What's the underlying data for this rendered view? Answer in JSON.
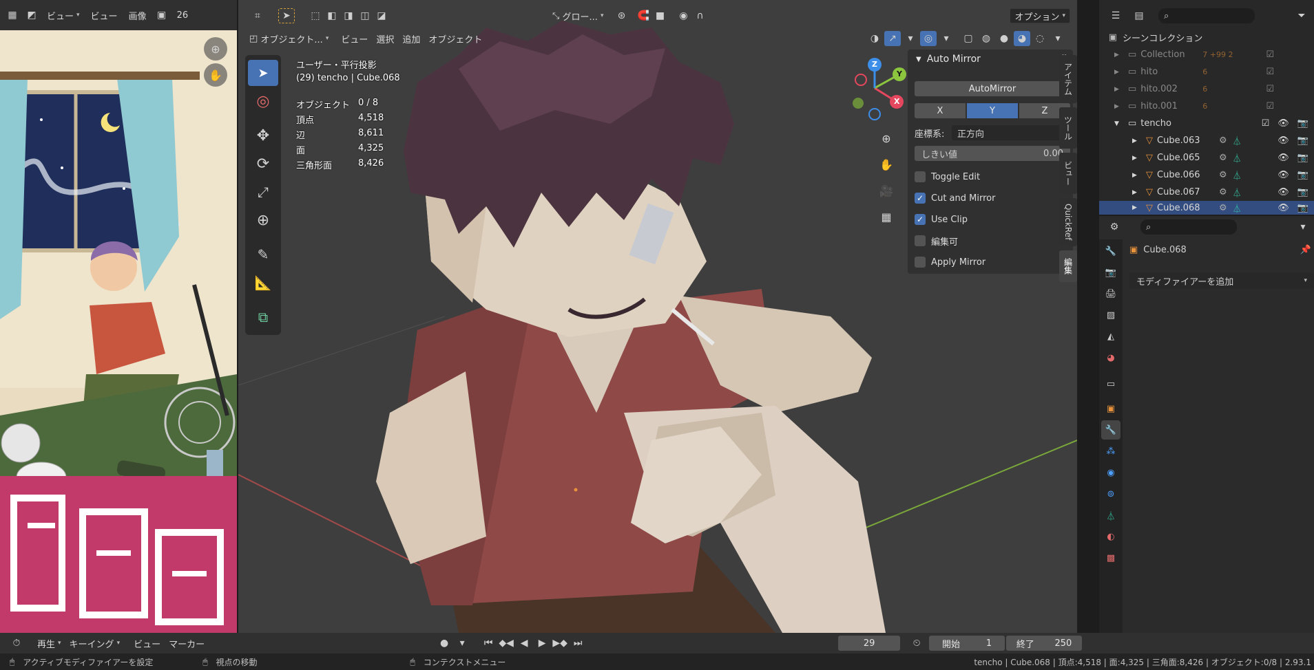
{
  "image_editor": {
    "view_menu_label": "ビュー",
    "view_label": "ビュー",
    "image_label": "画像",
    "zoom_hint": "26"
  },
  "viewport": {
    "transform_orientation": "グロー...",
    "options_label": "オプション",
    "mode": "オブジェクト...",
    "menus": [
      "ビュー",
      "選択",
      "追加",
      "オブジェクト"
    ],
    "projection": "ユーザー・平行投影",
    "active": "(29) tencho | Cube.068",
    "stats": [
      {
        "label": "オブジェクト",
        "value": "0 / 8"
      },
      {
        "label": "頂点",
        "value": "4,518"
      },
      {
        "label": "辺",
        "value": "8,611"
      },
      {
        "label": "面",
        "value": "4,325"
      },
      {
        "label": "三角形面",
        "value": "8,426"
      }
    ],
    "gizmo": {
      "x": "X",
      "y": "Y",
      "z": "Z"
    }
  },
  "npanel": {
    "title": "Auto Mirror",
    "automirror_button": "AutoMirror",
    "axes": [
      "X",
      "Y",
      "Z"
    ],
    "active_axis": "Y",
    "orientation_label": "座標系:",
    "orientation_value": "正方向",
    "threshold_label": "しきい値",
    "threshold_value": "0.00",
    "checks": [
      {
        "label": "Toggle Edit",
        "checked": false
      },
      {
        "label": "Cut and Mirror",
        "checked": true
      },
      {
        "label": "Use Clip",
        "checked": true
      },
      {
        "label": "編集可",
        "checked": false
      },
      {
        "label": "Apply Mirror",
        "checked": false
      }
    ],
    "tabs": [
      "アイテム",
      "ツール",
      "ビュー",
      "QuickRef",
      "編集"
    ],
    "active_tab": "編集"
  },
  "outliner": {
    "root": "シーンコレクション",
    "rows": [
      {
        "name": "Collection",
        "kind": "collection",
        "badges": "7 +99 2"
      },
      {
        "name": "hito",
        "kind": "collection",
        "badges": "6"
      },
      {
        "name": "hito.002",
        "kind": "collection",
        "badges": "6"
      },
      {
        "name": "hito.001",
        "kind": "collection",
        "badges": "6"
      },
      {
        "name": "tencho",
        "kind": "collection",
        "badges": ""
      },
      {
        "name": "Cube.063",
        "kind": "mesh",
        "badges": ""
      },
      {
        "name": "Cube.065",
        "kind": "mesh",
        "badges": ""
      },
      {
        "name": "Cube.066",
        "kind": "mesh",
        "badges": ""
      },
      {
        "name": "Cube.067",
        "kind": "mesh",
        "badges": ""
      },
      {
        "name": "Cube.068",
        "kind": "mesh",
        "badges": ""
      }
    ]
  },
  "properties": {
    "object_name": "Cube.068",
    "add_modifier": "モディファイアーを追加"
  },
  "timeline": {
    "playback": "再生",
    "keying": "キーイング",
    "view": "ビュー",
    "marker": "マーカー",
    "current_frame": "29",
    "start_label": "開始",
    "start_value": "1",
    "end_label": "終了",
    "end_value": "250"
  },
  "status": {
    "left_action": "アクティブモディファイアーを設定",
    "mid_action": "視点の移動",
    "right_action": "コンテクストメニュー",
    "info": "tencho | Cube.068 | 頂点:4,518 | 面:4,325 | 三角面:8,426 | オブジェクト:0/8 | 2.93.1"
  },
  "colors": {
    "accent": "#4772b3",
    "axis_x": "#e5475e",
    "axis_y": "#8cc63f",
    "axis_z": "#3d8ee8",
    "mesh_icon": "#e8923b",
    "data_icon": "#35c6a5"
  }
}
